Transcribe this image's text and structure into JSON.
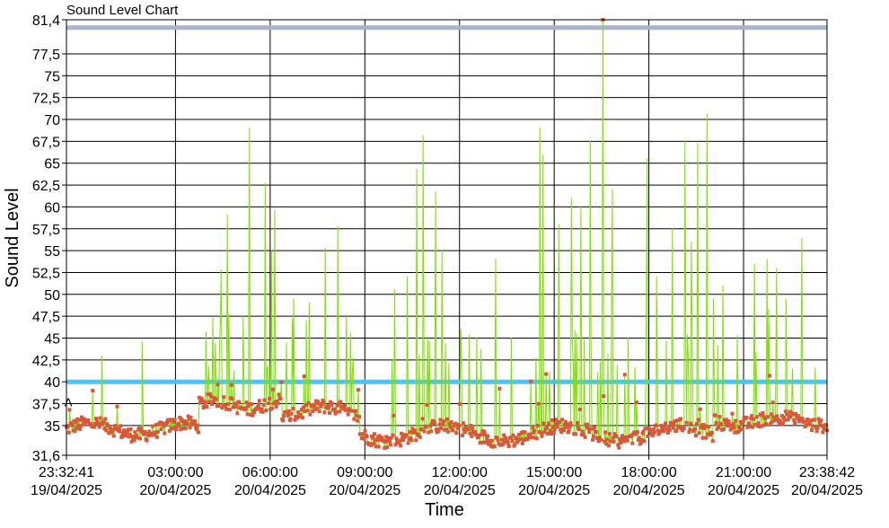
{
  "chart_data": {
    "type": "line",
    "title": "Sound Level Chart",
    "xlabel": "Time",
    "ylabel": "Sound Level",
    "ylim": [
      31.6,
      81.4
    ],
    "y_ticks": [
      "31,6",
      "35",
      "37,5",
      "40",
      "42,5",
      "45",
      "47,5",
      "50",
      "52,5",
      "55",
      "57,5",
      "60",
      "62,5",
      "65",
      "67,5",
      "70",
      "72,5",
      "75",
      "77,5",
      "81,4"
    ],
    "y_tick_values": [
      31.6,
      35,
      37.5,
      40,
      42.5,
      45,
      47.5,
      50,
      52.5,
      55,
      57.5,
      60,
      62.5,
      65,
      67.5,
      70,
      72.5,
      75,
      77.5,
      81.4
    ],
    "x_range_hours": [
      0,
      24.1
    ],
    "x_ticks": [
      {
        "time": "23:32:41",
        "date": "19/04/2025",
        "hour": 0
      },
      {
        "time": "03:00:00",
        "date": "20/04/2025",
        "hour": 3.455
      },
      {
        "time": "06:00:00",
        "date": "20/04/2025",
        "hour": 6.455
      },
      {
        "time": "09:00:00",
        "date": "20/04/2025",
        "hour": 9.455
      },
      {
        "time": "12:00:00",
        "date": "20/04/2025",
        "hour": 12.455
      },
      {
        "time": "15:00:00",
        "date": "20/04/2025",
        "hour": 15.455
      },
      {
        "time": "18:00:00",
        "date": "20/04/2025",
        "hour": 18.455
      },
      {
        "time": "21:00:00",
        "date": "20/04/2025",
        "hour": 21.455
      },
      {
        "time": "23:38:42",
        "date": "20/04/2025",
        "hour": 24.1
      }
    ],
    "reference_lines": [
      {
        "value": 80.5,
        "color": "#a8b4c8"
      },
      {
        "value": 40,
        "color": "#4fc3f7"
      }
    ],
    "marker_label": {
      "text": "A",
      "hour": 0.05,
      "value": 37.2
    },
    "series": [
      {
        "line_color": "#7fe000",
        "marker_color": "#d9573a",
        "peaks": [
          [
            0.1,
            36.8
          ],
          [
            2.4,
            44.6
          ],
          [
            4.5,
            41.8
          ],
          [
            4.9,
            52.8
          ],
          [
            5.1,
            59.1
          ],
          [
            5.6,
            47.5
          ],
          [
            5.8,
            69.0
          ],
          [
            6.3,
            62.7
          ],
          [
            6.5,
            55.0
          ],
          [
            6.6,
            59.6
          ],
          [
            7.2,
            49.5
          ],
          [
            7.6,
            47.0
          ],
          [
            8.2,
            55.3
          ],
          [
            8.6,
            57.8
          ],
          [
            9.0,
            45.6
          ],
          [
            10.4,
            50.5
          ],
          [
            10.8,
            52.0
          ],
          [
            11.1,
            64.3
          ],
          [
            11.3,
            68.2
          ],
          [
            11.7,
            61.7
          ],
          [
            11.9,
            55.0
          ],
          [
            12.5,
            46.0
          ],
          [
            13.0,
            45.0
          ],
          [
            13.6,
            54.0
          ],
          [
            14.1,
            45.0
          ],
          [
            15.0,
            69.0
          ],
          [
            15.1,
            66.0
          ],
          [
            15.6,
            58.0
          ],
          [
            16.0,
            61.0
          ],
          [
            16.3,
            60.0
          ],
          [
            16.6,
            67.5
          ],
          [
            17.0,
            81.4
          ],
          [
            17.3,
            62.0
          ],
          [
            17.8,
            45.0
          ],
          [
            18.4,
            65.5
          ],
          [
            18.7,
            52.0
          ],
          [
            19.2,
            57.5
          ],
          [
            19.6,
            67.5
          ],
          [
            19.8,
            56.0
          ],
          [
            20.0,
            67.3
          ],
          [
            20.3,
            70.6
          ],
          [
            20.5,
            49.5
          ],
          [
            20.8,
            51.0
          ],
          [
            21.8,
            53.5
          ],
          [
            22.2,
            54.0
          ],
          [
            22.5,
            53.0
          ],
          [
            22.8,
            49.5
          ],
          [
            23.3,
            56.4
          ]
        ]
      }
    ],
    "grid": true,
    "legend": "none"
  }
}
